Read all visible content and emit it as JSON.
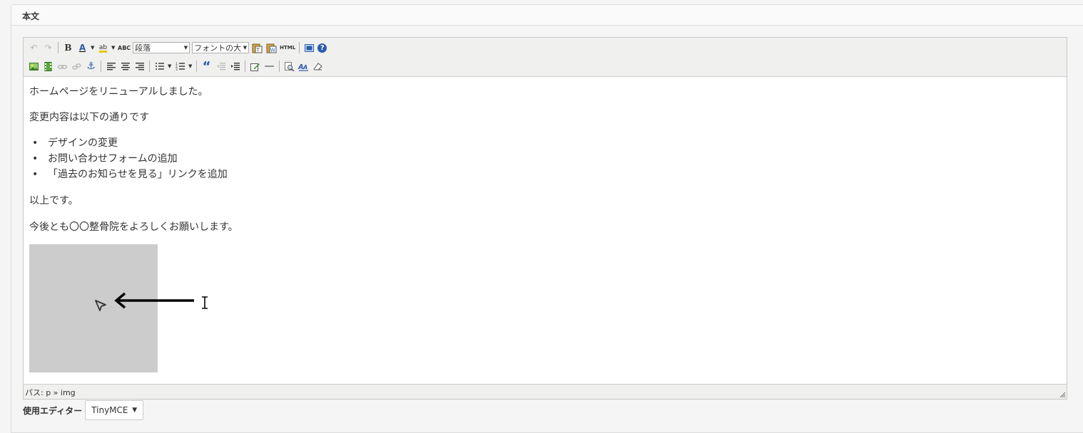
{
  "panel": {
    "title": "本文"
  },
  "toolbar": {
    "row1": {
      "undo_icon": "↶",
      "redo_icon": "↷",
      "bold_icon": "B",
      "forecolor_icon": "A",
      "backcolor_icon": "ab",
      "spellcheck_icon": "ABC",
      "format_select": "段落",
      "fontsize_select": "フォントの大",
      "html_icon": "HTML",
      "help_icon": "?"
    },
    "row2": {
      "anchor_icon": "⚓",
      "blockquote_icon": "“",
      "hr_icon": "—",
      "remove_format_icon": "⌫"
    }
  },
  "content": {
    "p1": "ホームページをリニューアルしました。",
    "p2": "変更内容は以下の通りです",
    "list": [
      "デザインの変更",
      "お問い合わせフォームの追加",
      "「過去のお知らせを見る」リンクを追加"
    ],
    "p3": "以上です。",
    "p4": "今後とも〇〇整骨院をよろしくお願いします。",
    "bullet": "•"
  },
  "statusbar": {
    "path": "パス: p » img"
  },
  "editor_selector": {
    "label": "使用エディター",
    "value": "TinyMCE",
    "caret": "▼"
  },
  "colors": {
    "image_placeholder": "#cccccc",
    "toolbar_bg": "#f0f0ee",
    "accent_blue": "#2a5caa"
  }
}
